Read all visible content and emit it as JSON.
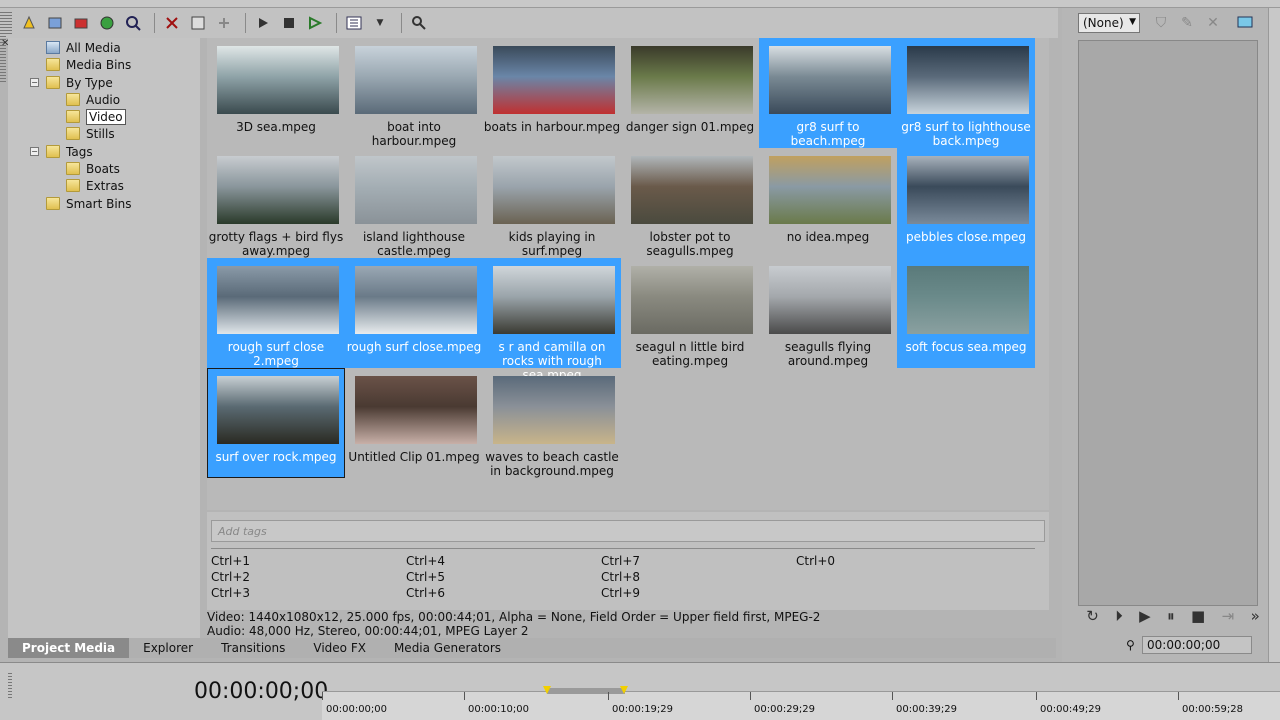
{
  "toolbar": {
    "buttons": [
      "import-icon",
      "capture-icon",
      "get-media-icon",
      "burn-icon",
      "refresh-icon",
      "properties-icon",
      "delete-icon",
      "media-fx-icon",
      "plugin-icon",
      "play-icon",
      "stop-icon",
      "auto-preview-icon",
      "views-icon",
      "search-icon"
    ]
  },
  "tree": {
    "all_media": "All Media",
    "media_bins": "Media Bins",
    "by_type": "By Type",
    "audio": "Audio",
    "video": "Video",
    "stills": "Stills",
    "tags": "Tags",
    "boats": "Boats",
    "extras": "Extras",
    "smart_bins": "Smart Bins",
    "collapse_symbol": "−"
  },
  "media": [
    {
      "label": "3D sea.mpeg",
      "selected": false
    },
    {
      "label": "boat into harbour.mpeg",
      "selected": false
    },
    {
      "label": "boats in harbour.mpeg",
      "selected": false
    },
    {
      "label": "danger sign 01.mpeg",
      "selected": false
    },
    {
      "label": "gr8 surf to beach.mpeg",
      "selected": true
    },
    {
      "label": "gr8 surf to lighthouse back.mpeg",
      "selected": true
    },
    {
      "label": "grotty flags + bird flys away.mpeg",
      "selected": false
    },
    {
      "label": "island lighthouse castle.mpeg",
      "selected": false
    },
    {
      "label": "kids playing in surf.mpeg",
      "selected": false
    },
    {
      "label": "lobster pot to seagulls.mpeg",
      "selected": false
    },
    {
      "label": "no idea.mpeg",
      "selected": false
    },
    {
      "label": "pebbles close.mpeg",
      "selected": true
    },
    {
      "label": "rough surf close 2.mpeg",
      "selected": true
    },
    {
      "label": "rough surf close.mpeg",
      "selected": true
    },
    {
      "label": "s r and camilla on rocks with rough sea.mpeg",
      "selected": true
    },
    {
      "label": "seagul n little bird eating.mpeg",
      "selected": false
    },
    {
      "label": "seagulls flying around.mpeg",
      "selected": false
    },
    {
      "label": "soft focus sea.mpeg",
      "selected": true
    },
    {
      "label": "surf over rock.mpeg",
      "selected": true
    },
    {
      "label": "Untitled Clip 01.mpeg",
      "selected": false
    },
    {
      "label": "waves to beach castle in background.mpeg",
      "selected": false
    }
  ],
  "tags_area": {
    "placeholder": "Add tags",
    "hotkeys": [
      "Ctrl+1",
      "Ctrl+2",
      "Ctrl+3",
      "Ctrl+4",
      "Ctrl+5",
      "Ctrl+6",
      "Ctrl+7",
      "Ctrl+8",
      "Ctrl+9",
      "Ctrl+0"
    ]
  },
  "info": {
    "video": "Video: 1440x1080x12, 25.000 fps, 00:00:44;01, Alpha = None, Field Order = Upper field first, MPEG-2",
    "audio": "Audio: 48,000 Hz, Stereo, 00:00:44;01, MPEG Layer 2"
  },
  "tabs": [
    "Project Media",
    "Explorer",
    "Transitions",
    "Video FX",
    "Media Generators"
  ],
  "preview": {
    "select_value": "(None)",
    "time": "00:00:00;00"
  },
  "timeline": {
    "timecode": "00:00:00;00",
    "ticks": [
      "00:00:00;00",
      "00:00:10;00",
      "00:00:19;29",
      "00:00:29;29",
      "00:00:39;29",
      "00:00:49;29",
      "00:00:59;28"
    ]
  },
  "colors": {
    "selection": "#3aa0ff",
    "loop_marker": "#f2d000"
  }
}
